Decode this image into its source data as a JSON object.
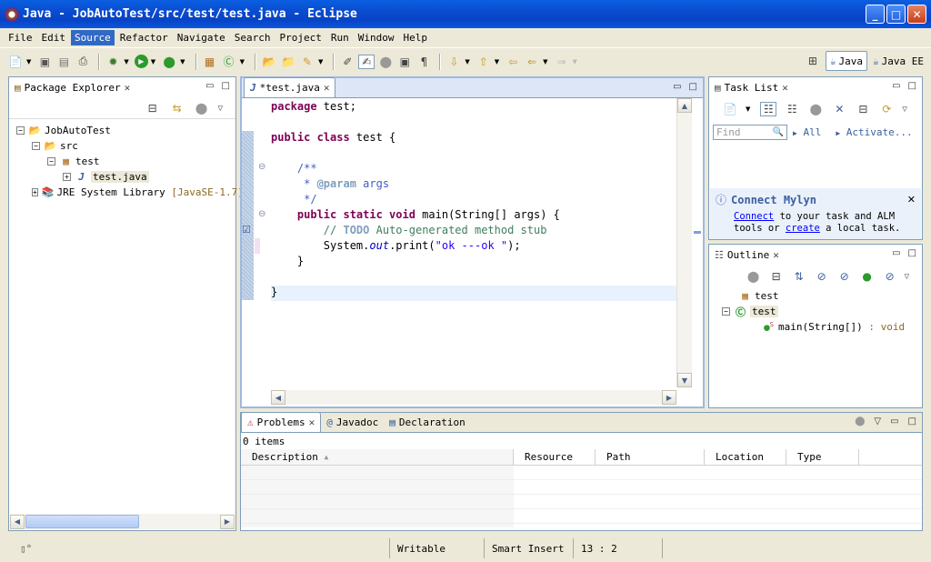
{
  "window": {
    "title": "Java - JobAutoTest/src/test/test.java - Eclipse"
  },
  "menu": [
    "File",
    "Edit",
    "Source",
    "Refactor",
    "Navigate",
    "Search",
    "Project",
    "Run",
    "Window",
    "Help"
  ],
  "menu_selected": "Source",
  "perspectives": [
    {
      "label": "Java",
      "active": true
    },
    {
      "label": "Java EE",
      "active": false
    }
  ],
  "package_explorer": {
    "title": "Package Explorer",
    "tree": {
      "project": "JobAutoTest",
      "src": "src",
      "package": "test",
      "file": "test.java",
      "jre": "JRE System Library",
      "jre_version": "[JavaSE-1.7]"
    }
  },
  "editor": {
    "tab": "*test.java",
    "code": {
      "l1_kw": "package",
      "l1_rest": " test;",
      "l2_kw": "public class",
      "l2_rest": " test {",
      "l3": "    /**",
      "l4_pre": "     * ",
      "l4_tag": "@param",
      "l4_rest": " args",
      "l5": "     */",
      "l6_pre": "    ",
      "l6_kw": "public static void",
      "l6_rest": " main(String[] args) {",
      "l7_pre": "        // ",
      "l7_todo": "TODO",
      "l7_rest": " Auto-generated method stub",
      "l8_pre": "        System.",
      "l8_out": "out",
      "l8_mid": ".print(",
      "l8_str": "\"ok ---ok \"",
      "l8_end": ");",
      "l9": "    }",
      "l10": "}"
    }
  },
  "task_list": {
    "title": "Task List",
    "find_placeholder": "Find",
    "all": "All",
    "activate": "Activate...",
    "mylyn_title": "Connect Mylyn",
    "mylyn_connect": "Connect",
    "mylyn_text1": " to your task and ALM",
    "mylyn_text2": "tools or ",
    "mylyn_create": "create",
    "mylyn_text3": " a local task."
  },
  "outline": {
    "title": "Outline",
    "items": [
      "test",
      "test",
      "main(String[])"
    ],
    "return_type": ": void"
  },
  "bottom": {
    "tabs": [
      "Problems",
      "Javadoc",
      "Declaration"
    ],
    "items_count": "0 items",
    "columns": [
      "Description",
      "Resource",
      "Path",
      "Location",
      "Type"
    ]
  },
  "status": {
    "writable": "Writable",
    "insert": "Smart Insert",
    "position": "13 : 2"
  },
  "colors": {
    "titlebar": "#0a4cd0",
    "keyword": "#7f0055",
    "comment": "#3f5fbf",
    "string": "#2a00ff",
    "link": "#0000ff"
  }
}
